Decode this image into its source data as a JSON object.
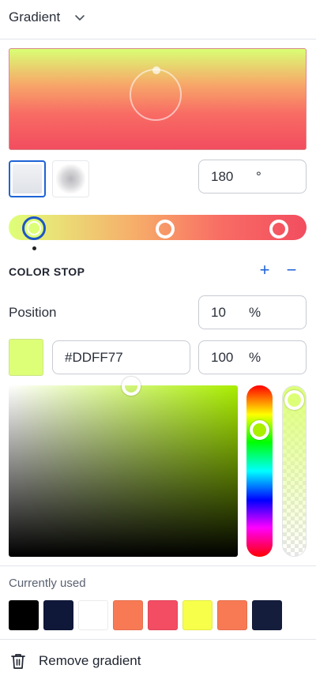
{
  "header": {
    "title": "Gradient",
    "dropdown_icon": "chevron-down-icon"
  },
  "preview": {
    "colors": [
      "#ddff77",
      "#f7a869",
      "#f86b64",
      "#f24d5f"
    ]
  },
  "gradient_types": [
    {
      "name": "linear",
      "selected": true
    },
    {
      "name": "radial",
      "selected": false
    }
  ],
  "angle": {
    "value": "180",
    "unit": "°"
  },
  "gradient_stops": [
    {
      "position_pct": 10,
      "selected": true
    },
    {
      "position_pct": 52,
      "selected": false
    },
    {
      "position_pct": 91,
      "selected": false
    }
  ],
  "color_stop": {
    "section_title": "COLOR STOP",
    "add_icon": "plus-icon",
    "remove_icon": "minus-icon",
    "position_label": "Position",
    "position_value": "10",
    "position_unit": "%",
    "hex_value": "#DDFF77",
    "opacity_value": "100",
    "opacity_unit": "%",
    "swatch_color": "#ddff77"
  },
  "picker": {
    "hue_color": "#aaee00",
    "saturation_handle": "top-center",
    "alpha_level": 1.0
  },
  "currently_used": {
    "label": "Currently used",
    "colors": [
      "#000000",
      "#10183a",
      "#ffffff",
      "#f87a55",
      "#f24d63",
      "#f7ff4a",
      "#f87a55",
      "#141d3c"
    ]
  },
  "footer": {
    "remove_label": "Remove gradient",
    "remove_icon": "trash-icon"
  },
  "accent_color": "#1e63d6"
}
